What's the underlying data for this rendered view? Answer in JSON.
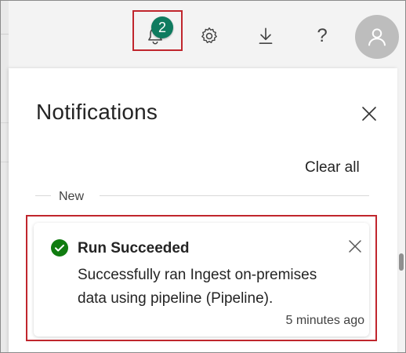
{
  "topbar": {
    "notifications_badge": "2",
    "icons": [
      "bell-icon",
      "gear-icon",
      "download-icon",
      "help-icon",
      "user-avatar-icon"
    ],
    "help_glyph": "?"
  },
  "panel": {
    "title": "Notifications",
    "clear_all_label": "Clear all",
    "section_label": "New"
  },
  "notification": {
    "status_color": "#107c10",
    "title": "Run Succeeded",
    "body": "Successfully ran Ingest on-premises data using pipeline (Pipeline).",
    "time": "5 minutes ago"
  },
  "colors": {
    "highlight_border": "#c0262d",
    "badge_bg": "#0f7b5f",
    "avatar_bg": "#bdbdbd"
  }
}
